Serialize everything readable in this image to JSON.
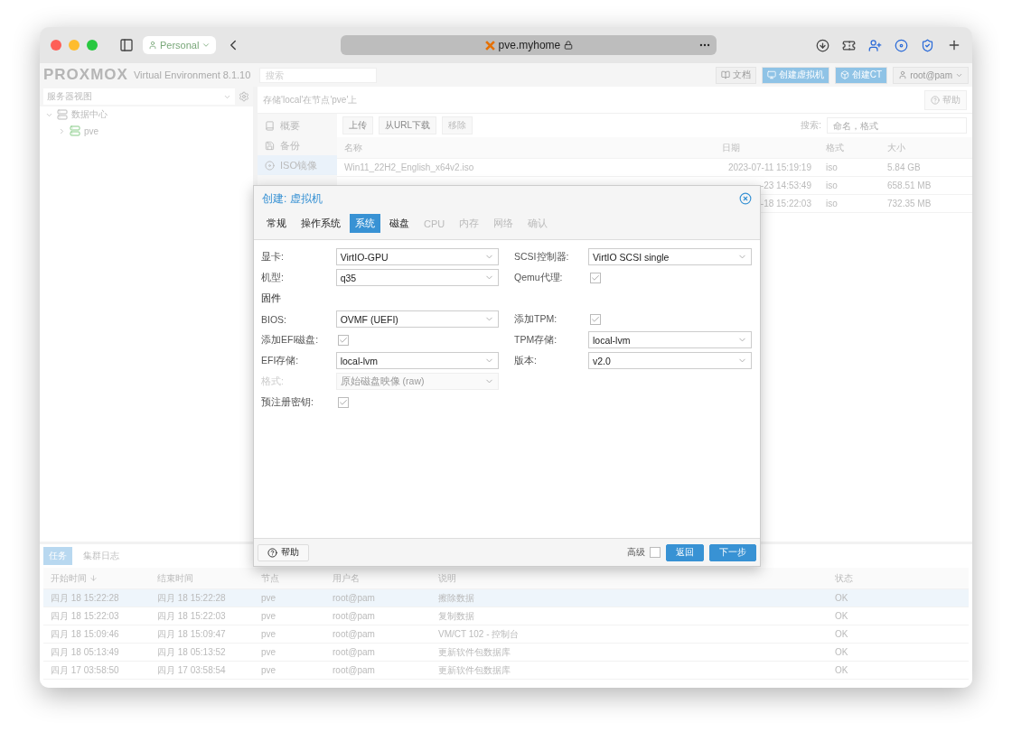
{
  "browser": {
    "profile": "Personal",
    "url": "pve.myhome"
  },
  "header": {
    "logo": "PROXMOX",
    "version": "Virtual Environment 8.1.10",
    "search_placeholder": "搜索",
    "buttons": [
      {
        "label": "文档",
        "kind": "docs"
      },
      {
        "label": "创建虚拟机",
        "kind": "vm"
      },
      {
        "label": "创建CT",
        "kind": "ct"
      }
    ],
    "user": "root@pam"
  },
  "sidebar": {
    "view": "服务器视图",
    "tree": [
      {
        "label": "数据中心",
        "expanded": true,
        "children": [
          {
            "label": "pve"
          }
        ]
      }
    ]
  },
  "content": {
    "title": "存储'local'在节点'pve'上",
    "help": "帮助",
    "nav": [
      {
        "label": "概要",
        "kind": "summary",
        "selected": false
      },
      {
        "label": "备份",
        "kind": "backup",
        "selected": false
      },
      {
        "label": "ISO镜像",
        "kind": "iso",
        "selected": true
      }
    ],
    "toolbar": [
      {
        "label": "上传",
        "disabled": false
      },
      {
        "label": "从URL下载",
        "disabled": false
      },
      {
        "label": "移除",
        "disabled": true
      }
    ],
    "search_label": "搜索:",
    "search_placeholder": "命名，格式",
    "columns": [
      "名称",
      "日期",
      "格式",
      "大小"
    ],
    "rows": [
      {
        "name": "Win11_22H2_English_x64v2.iso",
        "date": "2023-07-11 15:19:19",
        "format": "iso",
        "size": "5.84 GB"
      },
      {
        "date": "-23 14:53:49",
        "format": "iso",
        "size": "658.51 MB"
      },
      {
        "date": "-18 15:22:03",
        "format": "iso",
        "size": "732.35 MB"
      }
    ]
  },
  "dialog": {
    "title": "创建: 虚拟机",
    "tabs": [
      {
        "label": "常规",
        "selected": false,
        "disabled": false
      },
      {
        "label": "操作系统",
        "selected": false,
        "disabled": false
      },
      {
        "label": "系统",
        "selected": true,
        "disabled": false
      },
      {
        "label": "磁盘",
        "selected": false,
        "disabled": false
      },
      {
        "label": "CPU",
        "selected": false,
        "disabled": true
      },
      {
        "label": "内存",
        "selected": false,
        "disabled": true
      },
      {
        "label": "网络",
        "selected": false,
        "disabled": true
      },
      {
        "label": "确认",
        "selected": false,
        "disabled": true
      }
    ],
    "rows": [
      {
        "left": {
          "kind": "select",
          "label": "显卡:",
          "value": "VirtIO-GPU",
          "disabled": false
        },
        "right": {
          "kind": "select",
          "label": "SCSI控制器:",
          "value": "VirtIO SCSI single",
          "disabled": false
        }
      },
      {
        "left": {
          "kind": "select",
          "label": "机型:",
          "value": "q35",
          "disabled": false
        },
        "right": {
          "kind": "checkbox",
          "label": "Qemu代理:",
          "checked": true,
          "disabled": false
        }
      },
      {
        "left": {
          "kind": "heading",
          "label": "固件"
        }
      },
      {
        "left": {
          "kind": "select",
          "label": "BIOS:",
          "value": "OVMF (UEFI)",
          "disabled": false
        },
        "right": {
          "kind": "checkbox",
          "label": "添加TPM:",
          "checked": true,
          "disabled": false
        }
      },
      {
        "left": {
          "kind": "checkbox",
          "label": "添加EFI磁盘:",
          "checked": true,
          "disabled": false
        },
        "right": {
          "kind": "select",
          "label": "TPM存储:",
          "value": "local-lvm",
          "disabled": false
        }
      },
      {
        "left": {
          "kind": "select",
          "label": "EFI存储:",
          "value": "local-lvm",
          "disabled": false
        },
        "right": {
          "kind": "select",
          "label": "版本:",
          "value": "v2.0",
          "disabled": false
        }
      },
      {
        "left": {
          "kind": "select",
          "label": "格式:",
          "value": "原始磁盘映像 (raw)",
          "disabled": true
        }
      },
      {
        "left": {
          "kind": "checkbox",
          "label": "预注册密钥:",
          "checked": true,
          "disabled": false
        }
      }
    ],
    "help": "帮助",
    "advanced": {
      "label": "高级",
      "checked": false
    },
    "back": "返回",
    "next": "下一步"
  },
  "tasks": {
    "tabs": [
      {
        "label": "任务",
        "selected": true
      },
      {
        "label": "集群日志",
        "selected": false
      }
    ],
    "columns": [
      "开始时间",
      "结束时间",
      "节点",
      "用户名",
      "说明",
      "状态"
    ],
    "rows": [
      {
        "start": "四月 18 15:22:28",
        "end": "四月 18 15:22:28",
        "node": "pve",
        "user": "root@pam",
        "description": "擦除数据",
        "status": "OK",
        "selected": true
      },
      {
        "start": "四月 18 15:22:03",
        "end": "四月 18 15:22:03",
        "node": "pve",
        "user": "root@pam",
        "description": "复制数据",
        "status": "OK",
        "selected": false
      },
      {
        "start": "四月 18 15:09:46",
        "end": "四月 18 15:09:47",
        "node": "pve",
        "user": "root@pam",
        "description": "VM/CT 102 - 控制台",
        "status": "OK",
        "selected": false
      },
      {
        "start": "四月 18 05:13:49",
        "end": "四月 18 05:13:52",
        "node": "pve",
        "user": "root@pam",
        "description": "更新软件包数据库",
        "status": "OK",
        "selected": false
      },
      {
        "start": "四月 17 03:58:50",
        "end": "四月 17 03:58:54",
        "node": "pve",
        "user": "root@pam",
        "description": "更新软件包数据库",
        "status": "OK",
        "selected": false
      }
    ]
  }
}
